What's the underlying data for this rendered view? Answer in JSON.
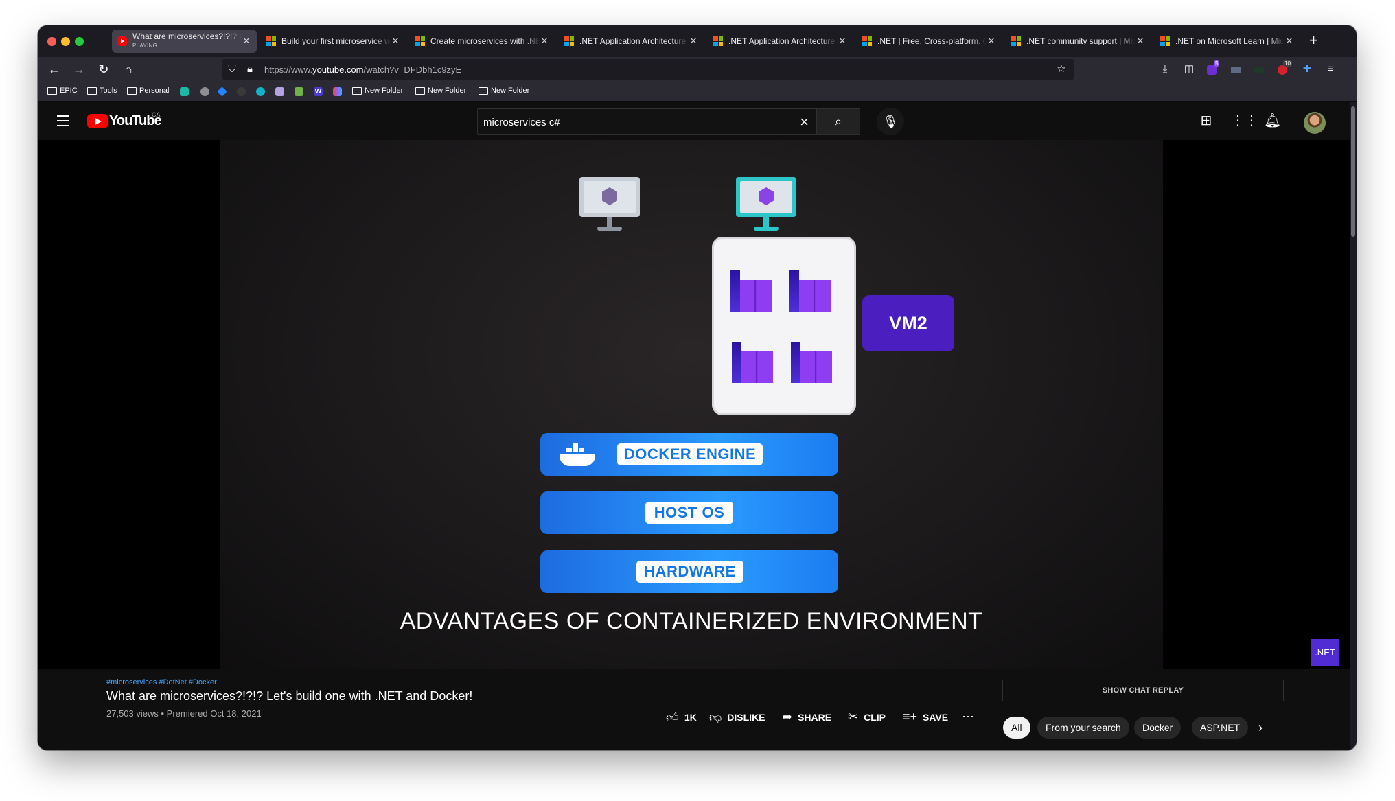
{
  "browser": {
    "tabs": [
      {
        "title": "What are microservices?!?!? Let's build one with .NET and Docker!",
        "subtitle": "PLAYING",
        "favicon": "youtube-icon"
      },
      {
        "title": "Build your first microservice with .NET",
        "favicon": "microsoft-icon"
      },
      {
        "title": "Create microservices with .NET and ASP.NET Core",
        "favicon": "microsoft-icon"
      },
      {
        "title": ".NET Application Architecture Guides",
        "favicon": "microsoft-icon"
      },
      {
        "title": ".NET Application Architecture Guides",
        "favicon": "microsoft-icon"
      },
      {
        "title": ".NET | Free. Cross-platform. Open Source.",
        "favicon": "microsoft-icon"
      },
      {
        "title": ".NET community support | Microsoft",
        "favicon": "microsoft-icon"
      },
      {
        "title": ".NET on Microsoft Learn | Microsoft",
        "favicon": "microsoft-icon"
      }
    ],
    "url": {
      "prefix": "https://www.",
      "domain": "youtube.com",
      "path": "/watch?v=DFDbh1c9zyE"
    },
    "bookmarks": [
      "EPIC",
      "Tools",
      "Personal",
      "New Folder",
      "New Folder",
      "New Folder"
    ],
    "extension_badges": {
      "first": "5",
      "second": "10"
    }
  },
  "youtube": {
    "logo_text": "YouTube",
    "country": "CA",
    "search_query": "microservices c#",
    "video": {
      "hashtags": "#microservices #DotNet #Docker",
      "title": "What are microservices?!?!? Let's build one with .NET and Docker!",
      "meta": "27,503 views • Premiered Oct 18, 2021",
      "actions": {
        "like": "1K",
        "dislike": "DISLIKE",
        "share": "SHARE",
        "clip": "CLIP",
        "save": "SAVE"
      },
      "slide": {
        "vm_label": "VM2",
        "layers": [
          "DOCKER ENGINE",
          "HOST OS",
          "HARDWARE"
        ],
        "caption": "ADVANTAGES OF CONTAINERIZED ENVIRONMENT"
      },
      "badge": ".NET"
    },
    "chat_replay": "SHOW CHAT REPLAY",
    "chips": [
      "All",
      "From your search",
      "Docker",
      "ASP.NET"
    ]
  },
  "colors": {
    "accent_red": "#ff0000",
    "dotnet_purple": "#512bd4",
    "link_blue": "#3ea6ff"
  }
}
